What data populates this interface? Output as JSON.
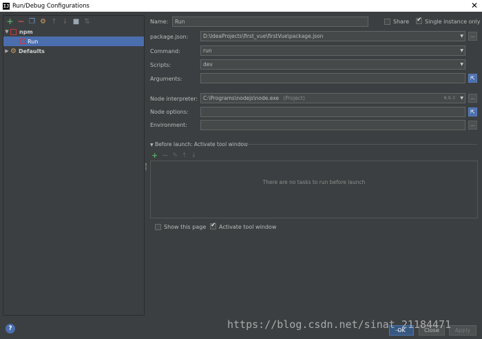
{
  "window": {
    "title": "Run/Debug Configurations",
    "logo": "IJ",
    "close": "✕"
  },
  "toolbar": {
    "icons": [
      "plus-icon",
      "minus-icon",
      "copy-icon",
      "gear-icon",
      "arrow-up-icon",
      "arrow-down-icon",
      "folder-icon",
      "sort-icon"
    ]
  },
  "tree": {
    "npm_label": "npm",
    "run_label": "Run",
    "defaults_label": "Defaults"
  },
  "form": {
    "name_label": "Name:",
    "name_value": "Run",
    "share_label": "Share",
    "single_instance_label": "Single instance only",
    "package_json_label": "package.json:",
    "package_json_value": "D:\\IdeaProjects\\first_vue\\firstVue\\package.json",
    "command_label": "Command:",
    "command_value": "run",
    "scripts_label": "Scripts:",
    "scripts_value": "dev",
    "arguments_label": "Arguments:",
    "arguments_value": "",
    "node_interpreter_label": "Node interpreter:",
    "node_interpreter_value": "C:\\Programs\\nodejs\\node.exe",
    "node_interpreter_hint": "(Project)",
    "node_version": "8.9.3",
    "node_options_label": "Node options:",
    "node_options_value": "",
    "environment_label": "Environment:",
    "environment_value": "",
    "browse_label": "...",
    "expand_label": "⇱"
  },
  "before_launch": {
    "title": "Before launch: Activate tool window",
    "empty_text": "There are no tasks to run before launch",
    "show_page_label": "Show this page",
    "activate_tool_window_label": "Activate tool window"
  },
  "buttons": {
    "ok": "OK",
    "close": "Close",
    "apply": "Apply",
    "help": "?"
  },
  "watermark": "https://blog.csdn.net/sinat_21184471",
  "colors": {
    "background": "#3c3f41",
    "selection": "#4b6eaf",
    "field": "#45494a",
    "npm_red": "#cb3837",
    "add_green": "#59a869",
    "remove_red": "#c75450"
  }
}
